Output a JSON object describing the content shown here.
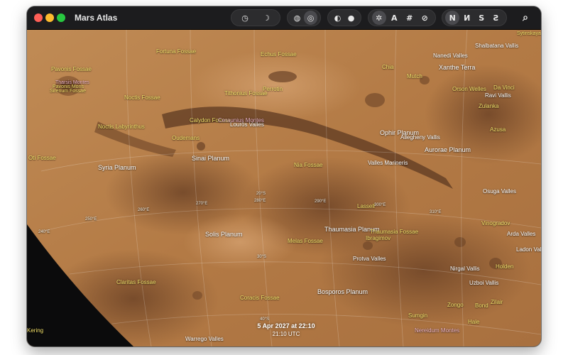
{
  "window": {
    "title": "Mars Atlas",
    "traffic_lights": {
      "close": "#ff5f57",
      "minimize": "#febc2e",
      "zoom": "#28c840"
    }
  },
  "toolbar": {
    "time_group": [
      {
        "name": "clock-icon",
        "glyph": "◷"
      },
      {
        "name": "moon-icon",
        "glyph": "☽"
      }
    ],
    "view_group": [
      {
        "name": "globe-icon",
        "glyph": "◍"
      },
      {
        "name": "globe-grid-icon",
        "glyph": "◎"
      }
    ],
    "shading_group": [
      {
        "name": "half-circle-icon",
        "glyph": "◐"
      },
      {
        "name": "full-circle-icon",
        "glyph": "●"
      }
    ],
    "overlay_group": [
      {
        "name": "feature-icon",
        "glyph": "✲"
      },
      {
        "name": "labels-icon",
        "glyph": "A"
      },
      {
        "name": "grid-icon",
        "glyph": "#"
      },
      {
        "name": "hide-icon",
        "glyph": "⊘"
      }
    ],
    "orientation_group": [
      {
        "name": "north-up-button",
        "glyph": "N"
      },
      {
        "name": "north-flipped-button",
        "glyph": "И"
      },
      {
        "name": "south-up-button",
        "glyph": "S"
      },
      {
        "name": "south-flipped-button",
        "glyph": "Ƨ"
      }
    ],
    "search_icon": "⌕"
  },
  "map": {
    "colors": {
      "terrain": "#b9804a",
      "dark_region": "#7a4e2e",
      "space": "#0b0b0c"
    },
    "white_labels": [
      "Syria Planum",
      "Sinai Planum",
      "Solis Planum",
      "Thaumasia Planum",
      "Bosporos Planum",
      "Ophir Planum",
      "Aurorae Planum",
      "Xanthe Terra",
      "Valles Marineris",
      "Lourös Valles",
      "Protva Valles",
      "Nirgal Vallis",
      "Uzboi Vallis",
      "Osuga Valles",
      "Arda Valles",
      "Ladon Valles",
      "Allegheny Vallis",
      "Nanedi Valles",
      "Shalbatana Vallis",
      "Ravi Vallis",
      "Warrego Valles"
    ],
    "yellow_labels": [
      "Fortuna Fossae",
      "Echus Fossae",
      "Pavonis Fossae",
      "Noctis Fossae",
      "Noctis Labyrinthus",
      "Tithonius Fossae",
      "Calydon Fossae",
      "Oudemans",
      "Oti Fossae",
      "Nia Fossae",
      "Lassell",
      "Claritas Fossae",
      "Melas Fossae",
      "Coracis Fossae",
      "Sumgin",
      "Zongo",
      "Bond",
      "Hale",
      "Zilair",
      "Holden",
      "Orson Welles",
      "Da Vinci",
      "Zulanka",
      "Azusa",
      "Chia",
      "Mutch",
      "Perrotin",
      "Ibragimov",
      "Vinogradov",
      "Sytinskaya",
      "Thaumasia Fossae",
      "Pavonis Mons",
      "Kering",
      "Sirenum Fossae"
    ],
    "pink_labels": [
      "Ceraunius Montes",
      "Nereidum Montes",
      "Tharsis Montes"
    ],
    "grid_labels": [
      "20°S",
      "30°S",
      "40°S",
      "240°E",
      "250°E",
      "260°E",
      "270°E",
      "280°E",
      "290°E",
      "300°E",
      "310°E"
    ]
  },
  "footer": {
    "date": "5 Apr 2027 at 22:10",
    "utc": "21:10 UTC"
  }
}
